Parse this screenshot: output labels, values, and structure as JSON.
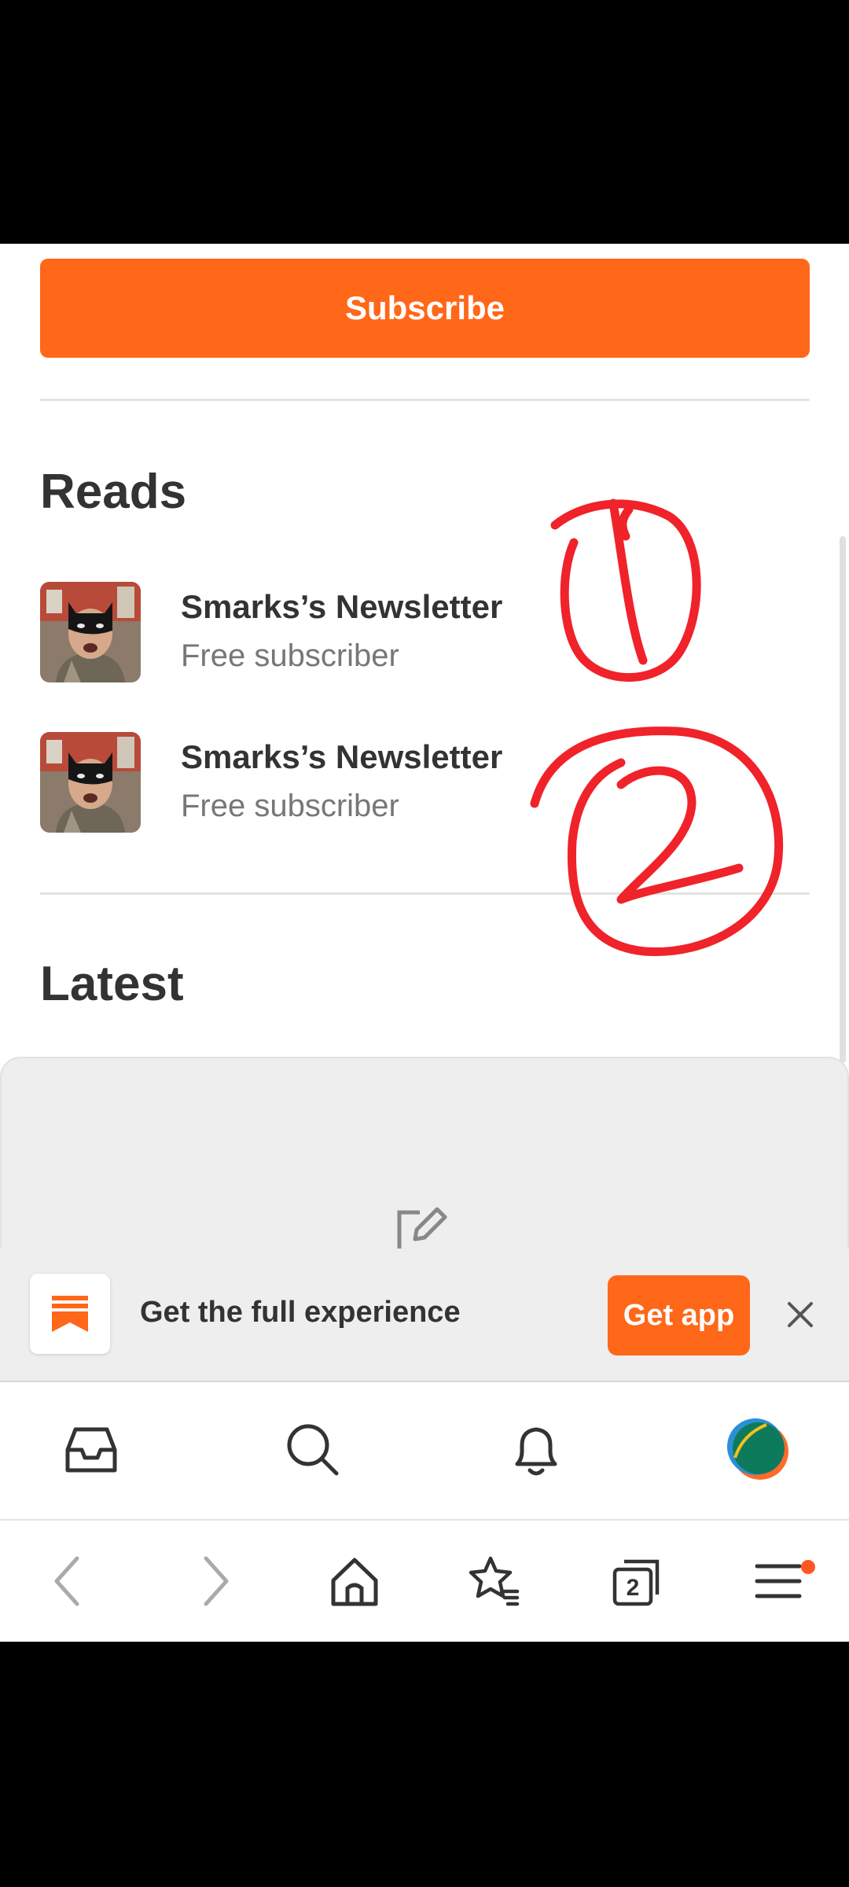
{
  "subscribe": {
    "label": "Subscribe"
  },
  "reads": {
    "title": "Reads",
    "items": [
      {
        "name": "Smarks’s Newsletter",
        "status": "Free subscriber"
      },
      {
        "name": "Smarks’s Newsletter",
        "status": "Free subscriber"
      }
    ]
  },
  "latest": {
    "title": "Latest"
  },
  "app_banner": {
    "text": "Get the full experience",
    "button": "Get app"
  },
  "bottom_nav": {
    "icons": [
      "inbox-icon",
      "search-icon",
      "bell-icon",
      "profile-avatar"
    ]
  },
  "browser_bar": {
    "tab_count": "2",
    "icons": [
      "back-icon",
      "forward-icon",
      "home-icon",
      "bookmark-star-icon",
      "tabs-icon",
      "menu-icon"
    ]
  },
  "colors": {
    "accent": "#ff6719",
    "annotation": "#f0222a"
  }
}
